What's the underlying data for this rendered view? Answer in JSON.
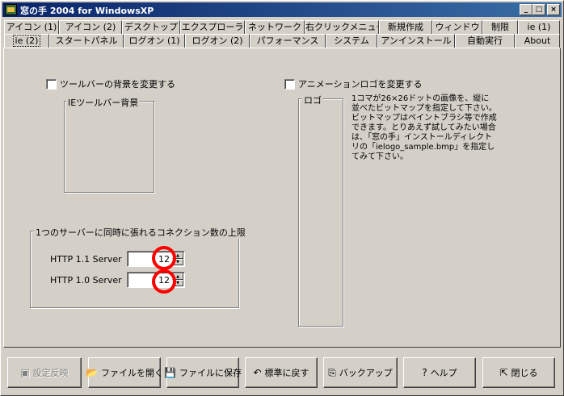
{
  "window": {
    "title": "窓の手 2004 for WindowsXP",
    "min_label": "_",
    "max_label": "□",
    "close_label": "×"
  },
  "tabs_row1": [
    "アイコン (1)",
    "アイコン (2)",
    "デスクトップ",
    "エクスプローラ",
    "ネットワーク",
    "右クリックメニュー",
    "新規作成",
    "ウィンドウ",
    "制限",
    "ie (1)"
  ],
  "tabs_row2": [
    "ie (2)",
    "スタートパネル",
    "ログオン (1)",
    "ログオン (2)",
    "パフォーマンス",
    "システム",
    "アンインストール",
    "自動実行",
    "About"
  ],
  "active_tab": "ie (2)",
  "toolbar_bg": {
    "checkbox_label": "ツールバーの背景を変更する",
    "group_title": "IEツールバー背景"
  },
  "animation_logo": {
    "checkbox_label": "アニメーションロゴを変更する",
    "group_title": "ロゴ",
    "description": "1コマが26×26ドットの画像を、縦に並べたビットマップを指定して下さい。ビットマップはペイントブラシ等で作成できます。とりあえず試してみたい場合は、「窓の手」インストールディレクトリの「ielogo_sample.bmp」を指定してみて下さい。"
  },
  "connections": {
    "group_title": "1つのサーバーに同時に張れるコネクション数の上限",
    "http11_label": "HTTP 1.1 Server",
    "http11_value": "12",
    "http10_label": "HTTP 1.0 Server",
    "http10_value": "12"
  },
  "buttons": {
    "apply": "設定反映",
    "open": "ファイルを開く",
    "save": "ファイルに保存",
    "reset": "標準に戻す",
    "backup": "バックアップ",
    "help": "ヘルプ",
    "close": "閉じる"
  },
  "colors": {
    "face": "#d4d0c8",
    "title_start": "#0a246a",
    "title_end": "#3a6ea5",
    "highlight_circle": "#ff0000"
  }
}
